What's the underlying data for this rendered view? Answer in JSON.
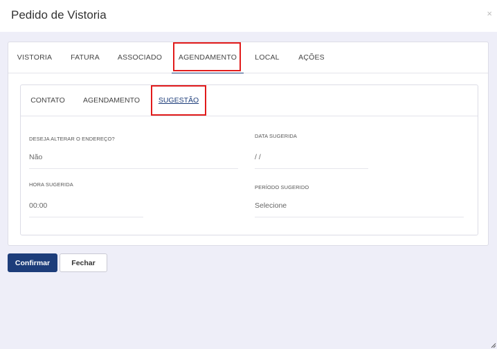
{
  "modal": {
    "title": "Pedido de Vistoria",
    "close_label": "×"
  },
  "outer_tabs": [
    {
      "label": "VISTORIA"
    },
    {
      "label": "FATURA"
    },
    {
      "label": "ASSOCIADO"
    },
    {
      "label": "AGENDAMENTO",
      "active": true
    },
    {
      "label": "LOCAL"
    },
    {
      "label": "AÇÕES"
    }
  ],
  "inner_tabs": [
    {
      "label": "CONTATO"
    },
    {
      "label": "AGENDAMENTO"
    },
    {
      "label": "SUGESTÃO",
      "active": true
    }
  ],
  "fields": {
    "alterar_endereco": {
      "label": "DESEJA ALTERAR O ENDEREÇO?",
      "value": "Não"
    },
    "data_sugerida": {
      "label": "DATA SUGERIDA",
      "value": "/ /"
    },
    "hora_sugerida": {
      "label": "HORA SUGERIDA",
      "value": "00:00"
    },
    "periodo_sugerido": {
      "label": "PERÍODO SUGERIDO",
      "value": "Selecione"
    }
  },
  "buttons": {
    "confirm": "Confirmar",
    "close": "Fechar"
  },
  "colors": {
    "primary": "#1d3d7a",
    "highlight": "#e11a1a",
    "background": "#eeeef8"
  }
}
